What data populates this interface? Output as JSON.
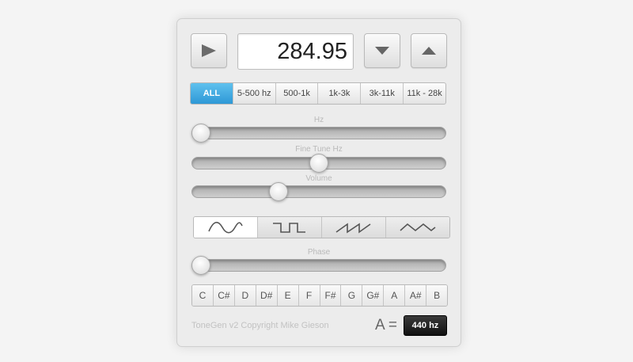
{
  "display": {
    "frequency": "284.95"
  },
  "ranges": [
    {
      "label": "ALL",
      "active": true
    },
    {
      "label": "5-500 hz",
      "active": false
    },
    {
      "label": "500-1k",
      "active": false
    },
    {
      "label": "1k-3k",
      "active": false
    },
    {
      "label": "3k-11k",
      "active": false
    },
    {
      "label": "11k - 28k",
      "active": false
    }
  ],
  "sliders": {
    "hz": {
      "label": "Hz",
      "value": 0.0
    },
    "fine_tune": {
      "label": "Fine Tune Hz",
      "value": 0.5
    },
    "volume": {
      "label": "Volume",
      "value": 0.33
    },
    "phase": {
      "label": "Phase",
      "value": 0.0
    }
  },
  "waveforms": [
    {
      "icon": "sine-wave-icon",
      "active": true
    },
    {
      "icon": "square-wave-icon",
      "active": false
    },
    {
      "icon": "sawtooth-wave-icon",
      "active": false
    },
    {
      "icon": "triangle-wave-icon",
      "active": false
    }
  ],
  "notes": [
    "C",
    "C#",
    "D",
    "D#",
    "E",
    "F",
    "F#",
    "G",
    "G#",
    "A",
    "A#",
    "B"
  ],
  "footer": {
    "copyright": "ToneGen v2 Copyright Mike Gieson",
    "a_equals": "A =",
    "reference": "440 hz"
  },
  "colors": {
    "accent": "#3aa6e0"
  }
}
